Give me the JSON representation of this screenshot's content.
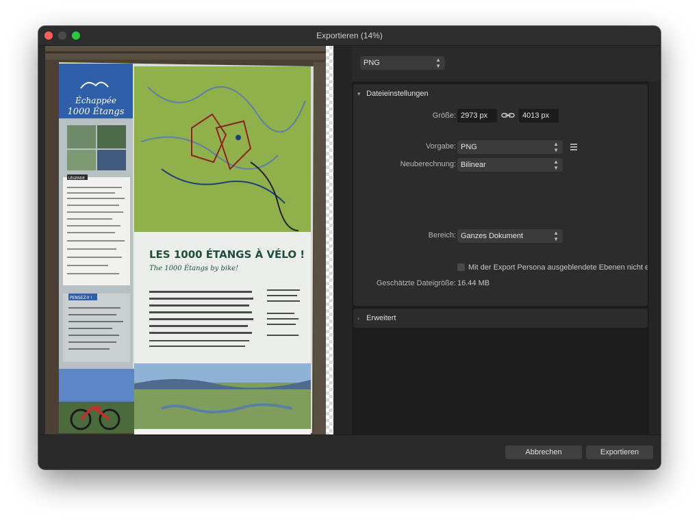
{
  "window": {
    "title": "Exportieren (14%)"
  },
  "format": {
    "selected": "PNG"
  },
  "dateieinstellungen": {
    "header": "Dateieinstellungen",
    "size_label": "Größe:",
    "width_value": "2973 px",
    "height_value": "4013 px",
    "preset_label": "Vorgabe:",
    "preset_value": "PNG",
    "resample_label": "Neuberechnung:",
    "resample_value": "Bilinear",
    "area_label": "Bereich:",
    "area_value": "Ganzes Dokument",
    "hidden_layers_label": "Mit der Export Persona ausgeblendete Ebenen nicht exp",
    "estimate_label": "Geschätzte Dateigröße:",
    "estimate_value": "16.44 MB"
  },
  "erweitert": {
    "header": "Erweitert"
  },
  "buttons": {
    "cancel": "Abbrechen",
    "export": "Exportieren"
  },
  "preview": {
    "logo_line1": "Échappée",
    "logo_line2": "1000 Étangs",
    "headline": "LES 1000 ÉTANGS À VÉLO !",
    "subheadline": "The 1000 Étangs by bike!",
    "legend_title": "LÉGENDE",
    "pensez_label": "PENSEZ-Y !"
  },
  "colors": {
    "poster_blue": "#2f5fa8",
    "map_green": "#8fb04a",
    "headline_green": "#1f4f3a",
    "wood": "#4b4035"
  }
}
